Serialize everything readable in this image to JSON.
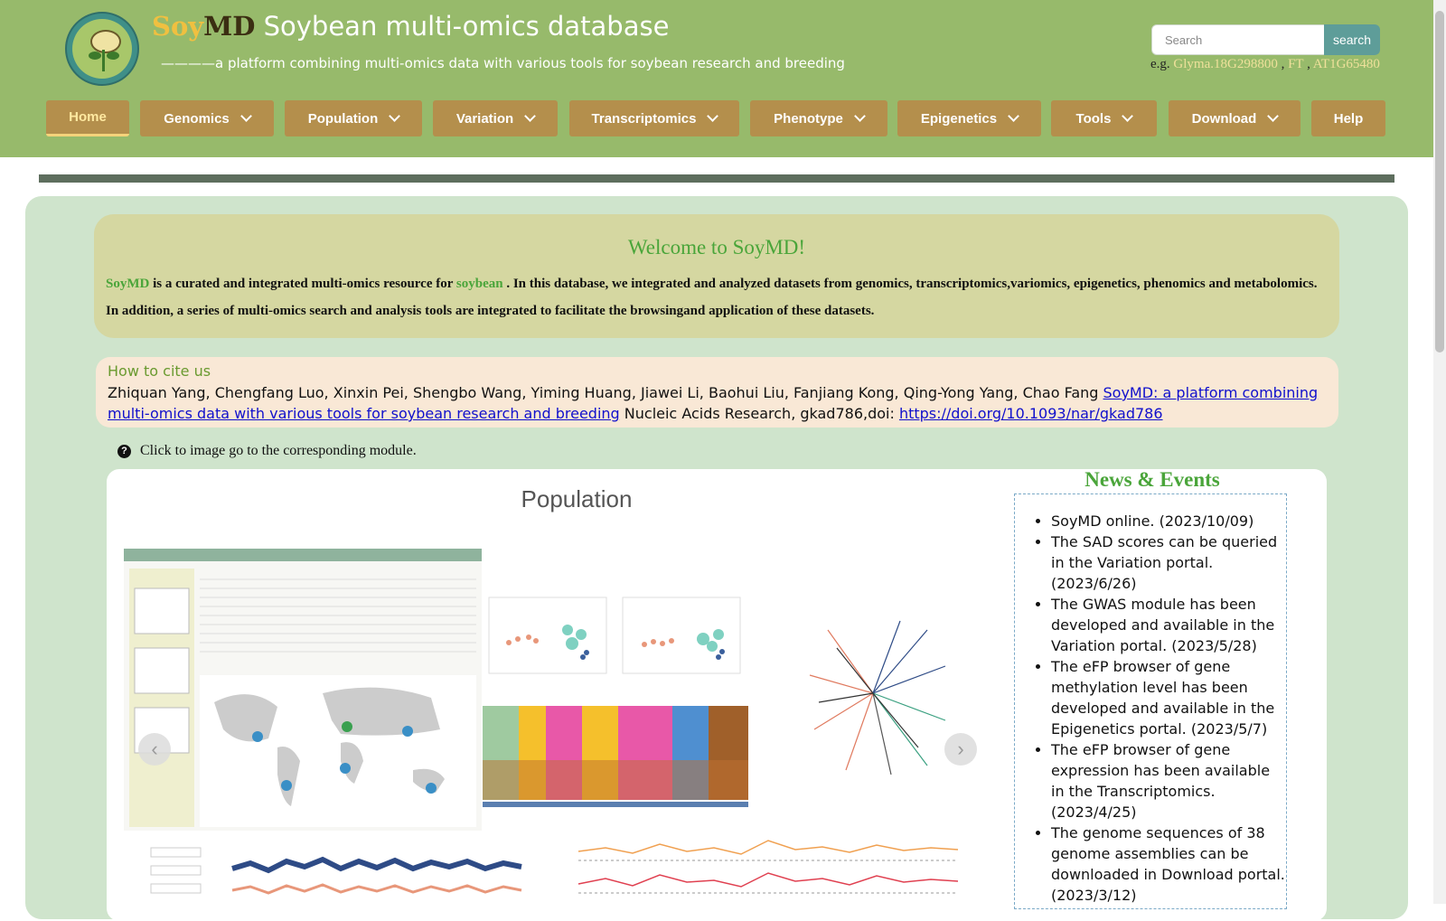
{
  "header": {
    "title_soy": "Soy",
    "title_md": "MD",
    "title_rest": " Soybean multi-omics database",
    "subtitle": "————a platform combining multi-omics data with various tools for soybean research and breeding",
    "search_placeholder": "Search",
    "search_button": "search",
    "eg_label": "e.g.",
    "examples": [
      "Glyma.18G298800",
      "FT",
      "AT1G65480"
    ],
    "example_sep": " , "
  },
  "nav": [
    {
      "label": "Home",
      "dropdown": false,
      "active": true
    },
    {
      "label": "Genomics",
      "dropdown": true
    },
    {
      "label": "Population",
      "dropdown": true
    },
    {
      "label": "Variation",
      "dropdown": true
    },
    {
      "label": "Transcriptomics",
      "dropdown": true
    },
    {
      "label": "Phenotype",
      "dropdown": true
    },
    {
      "label": "Epigenetics",
      "dropdown": true
    },
    {
      "label": "Tools",
      "dropdown": true
    },
    {
      "label": "Download",
      "dropdown": true
    },
    {
      "label": "Help",
      "dropdown": false
    }
  ],
  "welcome": {
    "title": "Welcome to SoyMD!",
    "soymd": "SoyMD",
    "part1": " is a curated and integrated multi-omics resource for ",
    "soybean": "soybean",
    "part2": " . In this database, we integrated and analyzed datasets from genomics, transcriptomics,variomics, epigenetics, phenomics and metabolomics. In addition, a series of multi-omics search and analysis tools are integrated to facilitate the browsingand application of these datasets."
  },
  "cite": {
    "heading": "How to cite us",
    "authors": "Zhiquan Yang, Chengfang Luo, Xinxin Pei, Shengbo Wang, Yiming Huang, Jiawei Li, Baohui Liu, Fanjiang Kong, Qing-Yong Yang, Chao Fang ",
    "paper_link": "SoyMD: a platform combining multi-omics data with various tools for soybean research and breeding",
    "journal": " Nucleic Acids Research, gkad786,doi: ",
    "doi_link": "https://doi.org/10.1093/nar/gkad786"
  },
  "hint": "Click to image go to the corresponding module.",
  "carousel": {
    "title": "Population",
    "prev_icon": "‹",
    "next_icon": "›"
  },
  "news": {
    "title": "News & Events",
    "items": [
      "SoyMD online. (2023/10/09)",
      "The SAD scores can be queried in the Variation portal. (2023/6/26)",
      "The GWAS module has been developed and available in the Variation portal. (2023/5/28)",
      "The eFP browser of gene methylation level has been developed and available in the Epigenetics portal. (2023/5/7)",
      "The eFP browser of gene expression has been available in the Transcriptomics. (2023/4/25)",
      "The genome sequences of 38 genome assemblies can be downloaded in Download portal. (2023/3/12)"
    ]
  },
  "colors": {
    "header_bg": "#97ba6b",
    "nav_bg": "#b48f4c",
    "accent_green": "#4aa53a",
    "main_bg": "#cfe4cc"
  }
}
